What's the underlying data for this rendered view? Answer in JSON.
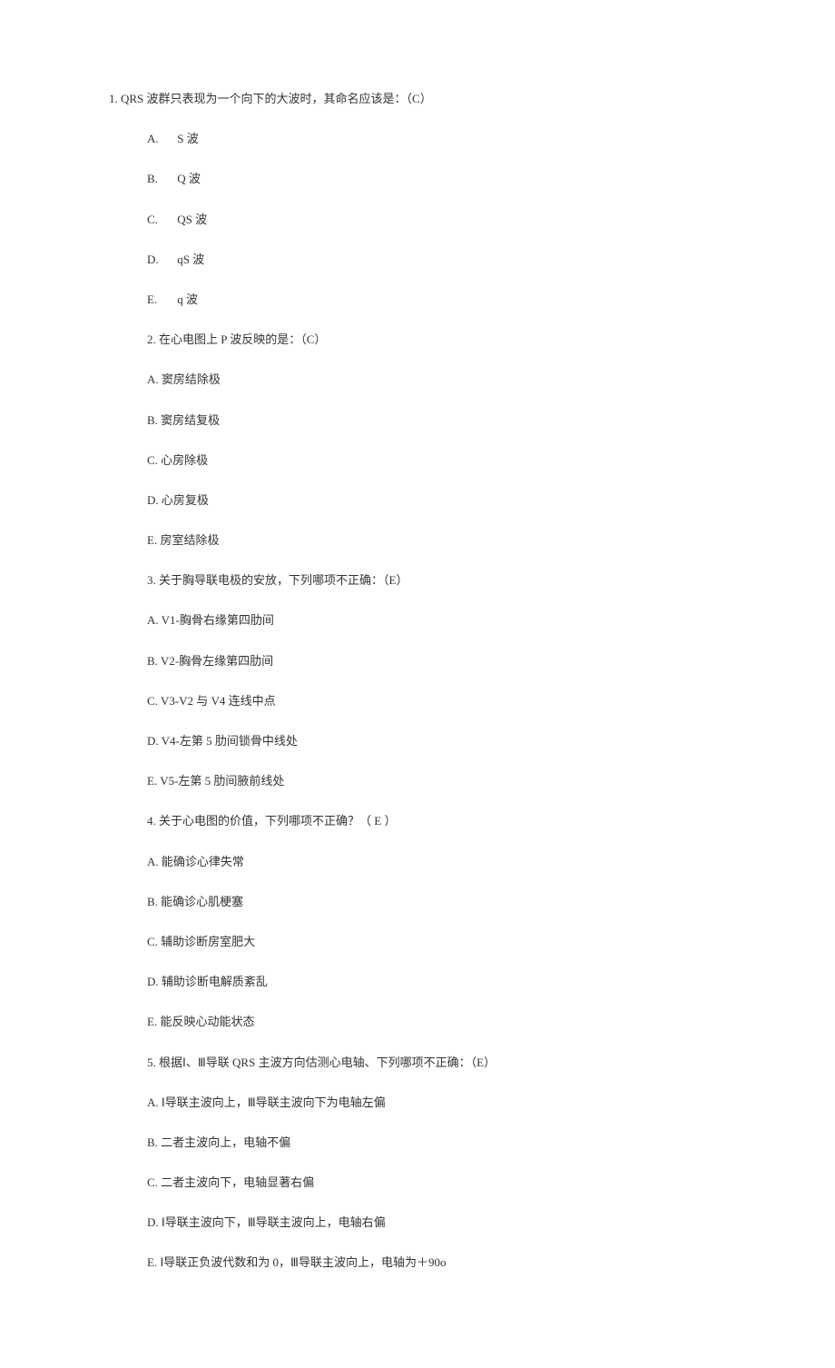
{
  "q1": {
    "stem": "1. QRS 波群只表现为一个向下的大波时，其命名应该是：（C）",
    "opts": {
      "A": "A.",
      "A_text": "S 波",
      "B": "B.",
      "B_text": "Q 波",
      "C": "C.",
      "C_text": "QS 波",
      "D": "D.",
      "D_text": "qS 波",
      "E": "E.",
      "E_text": "q 波"
    }
  },
  "q2": {
    "stem": "2. 在心电图上 P 波反映的是：（C）",
    "opts": {
      "A": "A. 窦房结除极",
      "B": "B. 窦房结复极",
      "C": "C. 心房除极",
      "D": "D. 心房复极",
      "E": "E. 房室结除极"
    }
  },
  "q3": {
    "stem": "3. 关于胸导联电极的安放，下列哪项不正确：（E）",
    "opts": {
      "A": "A. V1-胸骨右缘第四肋间",
      "B": "B. V2-胸骨左缘第四肋间",
      "C": "C. V3-V2 与 V4 连线中点",
      "D": "D. V4-左第 5 肋间锁骨中线处",
      "E": "E. V5-左第 5 肋间腋前线处"
    }
  },
  "q4": {
    "stem": "4. 关于心电图的价值，下列哪项不正确？（  E  ）",
    "opts": {
      "A": "A. 能确诊心律失常",
      "B": "B. 能确诊心肌梗塞",
      "C": "C. 辅助诊断房室肥大",
      "D": "D. 辅助诊断电解质紊乱",
      "E": "E. 能反映心动能状态"
    }
  },
  "q5": {
    "stem": "5. 根据Ⅰ、Ⅲ导联 QRS 主波方向估测心电轴、下列哪项不正确：（E）",
    "opts": {
      "A": "A. Ⅰ导联主波向上，Ⅲ导联主波向下为电轴左偏",
      "B": "B. 二者主波向上，电轴不偏",
      "C": "C. 二者主波向下，电轴显著右偏",
      "D": "D. Ⅰ导联主波向下，Ⅲ导联主波向上，电轴右偏",
      "E": "E. Ⅰ导联正负波代数和为 0，Ⅲ导联主波向上，电轴为＋90o"
    }
  }
}
